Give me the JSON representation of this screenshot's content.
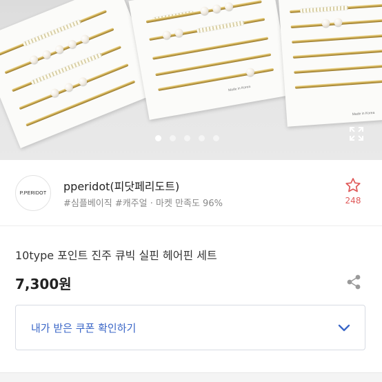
{
  "carousel": {
    "card_text": "Made in Korea",
    "slide_count": 5,
    "active_index": 0
  },
  "seller": {
    "logo_text": "P.PERIDOT",
    "name": "pperidot(피닷페리도트)",
    "tags": "#심플베이직 #캐주얼 · 마켓 만족도 96%",
    "favorite_count": "248"
  },
  "product": {
    "title": "10type 포인트 진주 큐빅 실핀 헤어핀 세트",
    "price": "7,300원"
  },
  "coupon": {
    "label": "내가 받은 쿠폰 확인하기"
  },
  "colors": {
    "accent_blue": "#3a66c7",
    "favorite_red": "#e05a5a"
  },
  "icons": {
    "expand": "expand-icon",
    "favorite": "star-outline-icon",
    "share": "share-icon",
    "chevron": "chevron-down-icon"
  }
}
